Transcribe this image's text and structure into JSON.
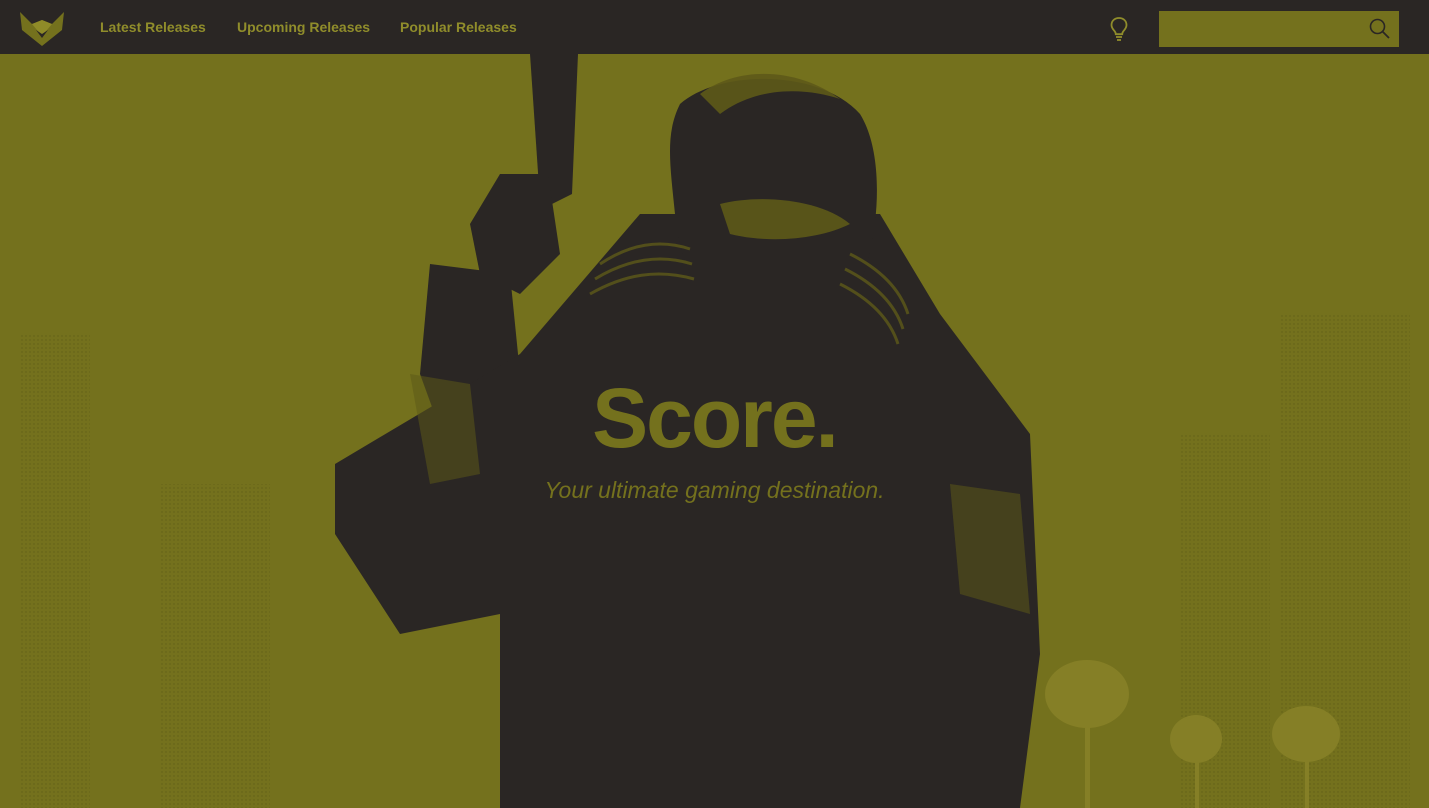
{
  "nav": {
    "logo_icon": "fox-logo-icon",
    "links": [
      "Latest Releases",
      "Upcoming Releases",
      "Popular Releases"
    ],
    "theme_icon": "lightbulb-icon",
    "search": {
      "value": "",
      "placeholder": "",
      "icon": "search-icon"
    }
  },
  "hero": {
    "title": "Score.",
    "subtitle": "Your ultimate gaming destination.",
    "image_icon": "hero-character-illustration"
  },
  "colors": {
    "nav_bg": "#2a2624",
    "accent": "#74711d",
    "nav_text": "#908d2b",
    "dark": "#2a2624"
  }
}
